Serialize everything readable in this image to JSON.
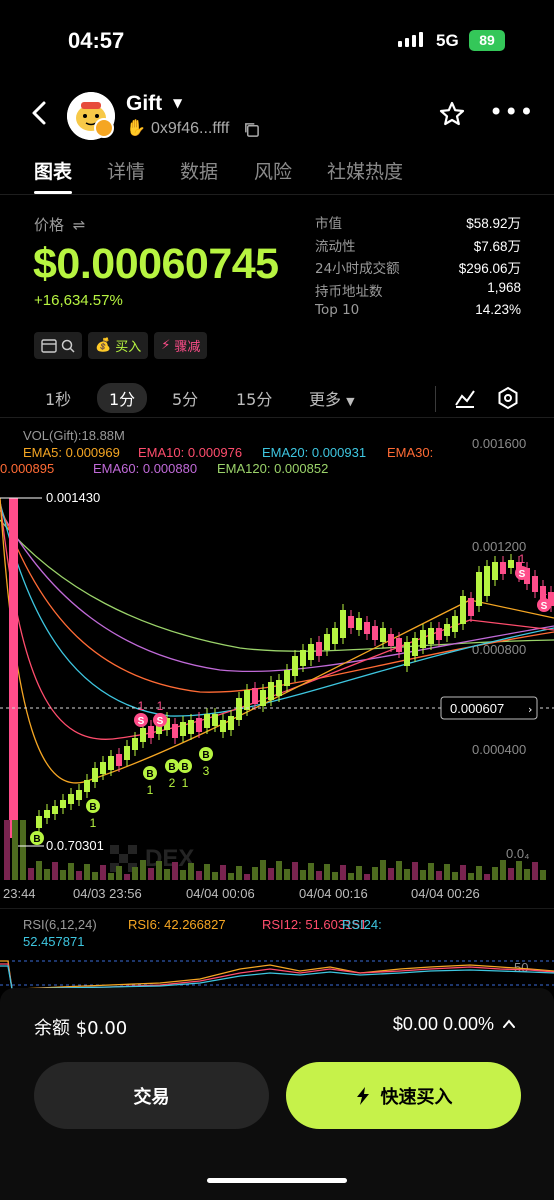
{
  "status": {
    "time": "04:57",
    "network": "5G",
    "battery": "89"
  },
  "header": {
    "token": "Gift",
    "address": "0x9f46...ffff"
  },
  "tabs": [
    "图表",
    "详情",
    "数据",
    "风险",
    "社媒热度"
  ],
  "price": {
    "label": "价格",
    "swap_icon": "⇌",
    "value": "$0.00060745",
    "change": "+16,634.57%"
  },
  "stats": [
    {
      "label": "市值",
      "value": "$58.92万"
    },
    {
      "label": "流动性",
      "value": "$7.68万"
    },
    {
      "label": "24小时成交额",
      "value": "$296.06万"
    },
    {
      "label": "持币地址数",
      "value": "1,968"
    },
    {
      "label": "Top 10",
      "value": "14.23%"
    }
  ],
  "actions": {
    "buy": "买入",
    "sell": "骤减"
  },
  "intervals": [
    "1秒",
    "1分",
    "5分",
    "15分",
    "更多"
  ],
  "chart": {
    "vol_label": "VOL(Gift):18.88M",
    "ema5": "EMA5: 0.000969",
    "ema10": "EMA10: 0.000976",
    "ema20": "EMA20: 0.000931",
    "ema30_a": "EMA30:",
    "ema30_b": "0.000895",
    "ema60": "EMA60: 0.000880",
    "ema120": "EMA120: 0.000852",
    "y_labels": [
      "0.001600",
      "0.001200",
      "0.000800",
      "0.000400"
    ],
    "high_label": "0.001430",
    "low_label": "0.0.70301",
    "current_label": "0.000607",
    "vol_axis": "0.0₄",
    "watermark": "DEX",
    "x_labels": [
      "23:44",
      "04/03 23:56",
      "04/04 00:06",
      "04/04 00:16",
      "04/04 00:26"
    ],
    "marker_b": "B",
    "marker_s": "S"
  },
  "rsi": {
    "label": "RSI(6,12,24)",
    "rsi6": "RSI6: 42.266827",
    "rsi12": "RSI12: 51.603151",
    "rsi24_a": "RSI24:",
    "rsi24_b": "52.457871",
    "level": "50"
  },
  "bottom": {
    "balance": "余额 $0.00",
    "right": "$0.00 0.00%",
    "trade": "交易",
    "quick_buy": "快速买入"
  },
  "colors": {
    "accent": "#b7f441",
    "sell": "#ff4d8a",
    "ema5": "#f5a623",
    "ema10": "#ff4d6d",
    "ema20": "#3ec6e0",
    "ema30": "#ff6b35",
    "ema60": "#c06ad8",
    "ema120": "#9bd36a"
  }
}
